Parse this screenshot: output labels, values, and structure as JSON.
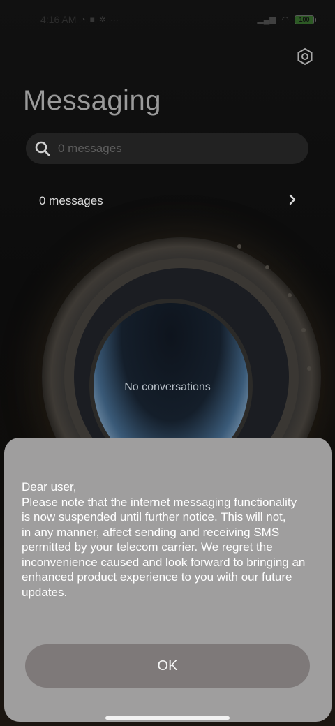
{
  "status_bar": {
    "time": "4:16 AM",
    "battery": "100",
    "icons": [
      "sync-icon",
      "app-icon",
      "settings-small-icon",
      "more-dots-icon",
      "signal-icon",
      "wifi-icon"
    ]
  },
  "header": {
    "title": "Messaging",
    "settings_icon": "gear-icon"
  },
  "search": {
    "placeholder": "0 messages",
    "icon": "search-icon"
  },
  "folder": {
    "label": "0 messages",
    "icon": "chevron-right-icon"
  },
  "empty_state": {
    "text": "No conversations"
  },
  "dialog": {
    "message_lines": [
      "Dear user,",
      "Please note that the internet messaging functionality",
      "is now suspended until further notice. This will not,",
      "in any manner, affect sending and receiving SMS",
      "permitted by your telecom carrier. We regret the",
      "inconvenience caused and look forward to bringing an",
      "enhanced product experience to you with our future",
      "updates."
    ],
    "ok_label": "OK"
  },
  "colors": {
    "dialog_bg": "#9f9e9e",
    "button_bg": "#7e7979",
    "screen_bg": "#0c0c0c"
  }
}
